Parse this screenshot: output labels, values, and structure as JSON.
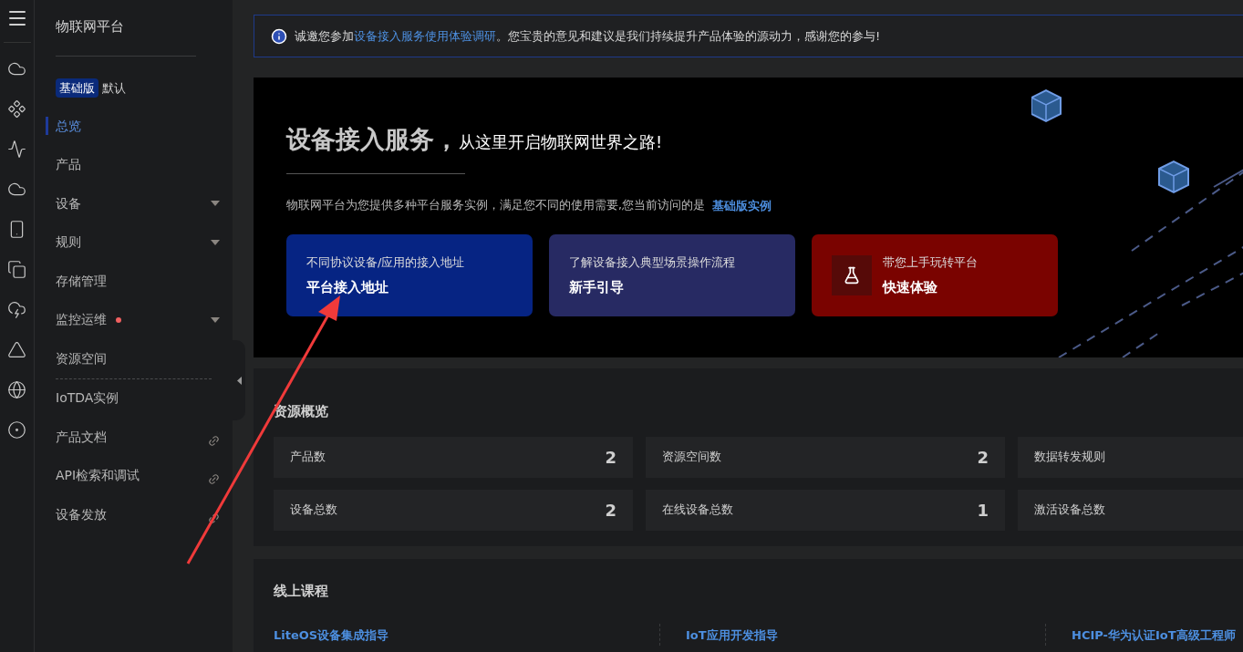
{
  "sidebar": {
    "title": "物联网平台",
    "edition_badge": "基础版",
    "edition_name": "默认",
    "groups": [
      {
        "items": [
          {
            "label": "总览",
            "selected": true,
            "expandable": false,
            "external": false,
            "alert_dot": false
          },
          {
            "label": "产品",
            "selected": false,
            "expandable": false,
            "external": false,
            "alert_dot": false
          },
          {
            "label": "设备",
            "selected": false,
            "expandable": true,
            "external": false,
            "alert_dot": false
          },
          {
            "label": "规则",
            "selected": false,
            "expandable": true,
            "external": false,
            "alert_dot": false
          },
          {
            "label": "存储管理",
            "selected": false,
            "expandable": false,
            "external": false,
            "alert_dot": false
          },
          {
            "label": "监控运维",
            "selected": false,
            "expandable": true,
            "external": false,
            "alert_dot": true
          },
          {
            "label": "资源空间",
            "selected": false,
            "expandable": false,
            "external": false,
            "alert_dot": false
          }
        ]
      },
      {
        "items": [
          {
            "label": "IoTDA实例",
            "selected": false,
            "expandable": false,
            "external": false,
            "alert_dot": false
          },
          {
            "label": "产品文档",
            "selected": false,
            "expandable": false,
            "external": true,
            "alert_dot": false
          },
          {
            "label": "API检索和调试",
            "selected": false,
            "expandable": false,
            "external": true,
            "alert_dot": false
          },
          {
            "label": "设备发放",
            "selected": false,
            "expandable": false,
            "external": true,
            "alert_dot": false
          }
        ]
      }
    ]
  },
  "notice": {
    "before": "诚邀您参加",
    "link": "设备接入服务使用体验调研",
    "after": "。您宝贵的意见和建议是我们持续提升产品体验的源动力，感谢您的参与!"
  },
  "banner": {
    "title": "设备接入服务，",
    "subtitle": "从这里开启物联网世界之路!",
    "description": "物联网平台为您提供多种平台服务实例，满足您不同的使用需要,您当前访问的是",
    "instance_link": "基础版实例",
    "cards": [
      {
        "kind": "plain",
        "caption": "不同协议设备/应用的接入地址",
        "title": "平台接入地址",
        "color": "#062483"
      },
      {
        "kind": "plain",
        "caption": "了解设备接入典型场景操作流程",
        "title": "新手引导",
        "color": "#272a63"
      },
      {
        "kind": "flask",
        "caption": "带您上手玩转平台",
        "title": "快速体验",
        "color": "#7a0300"
      }
    ]
  },
  "resources": {
    "title": "资源概览",
    "stats": [
      {
        "label": "产品数",
        "value": "2"
      },
      {
        "label": "资源空间数",
        "value": "2"
      },
      {
        "label": "数据转发规则"
      },
      {
        "label": "设备总数",
        "value": "2"
      },
      {
        "label": "在线设备总数",
        "value": "1"
      },
      {
        "label": "激活设备总数"
      }
    ]
  },
  "courses": {
    "title": "线上课程",
    "items": [
      "LiteOS设备集成指导",
      "IoT应用开发指导",
      "HCIP-华为认证IoT高级工程师"
    ]
  }
}
